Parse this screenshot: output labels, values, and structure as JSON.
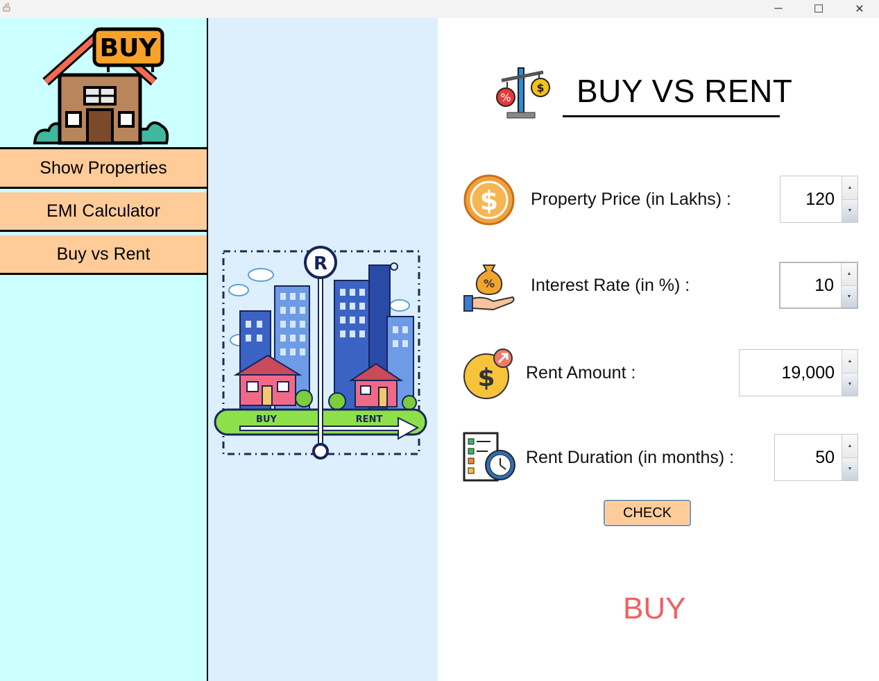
{
  "window": {
    "minimize_glyph": "─",
    "maximize_glyph": "☐",
    "close_glyph": "✕"
  },
  "sidebar": {
    "logo_text": "BUY",
    "items": [
      {
        "label": "Show Properties"
      },
      {
        "label": "EMI Calculator"
      },
      {
        "label": "Buy vs Rent"
      }
    ]
  },
  "illustration": {
    "left_label": "BUY",
    "right_label": "RENT",
    "center_letter": "R"
  },
  "main": {
    "title": "BUY VS RENT",
    "fields": [
      {
        "label": "Property Price (in Lakhs) :",
        "value": "120",
        "icon": "dollar-coin-icon"
      },
      {
        "label": "Interest Rate (in %) :",
        "value": "10",
        "icon": "money-bag-hand-icon"
      },
      {
        "label": "Rent Amount :",
        "value": "19,000",
        "icon": "dollar-growth-icon"
      },
      {
        "label": "Rent Duration (in months) :",
        "value": "50",
        "icon": "checklist-clock-icon"
      }
    ],
    "check_label": "CHECK",
    "result": "BUY"
  },
  "colors": {
    "sidebar_bg": "#ccffff",
    "nav_button_bg": "#ffcc99",
    "middle_bg": "#ddeefc",
    "result_text": "#f06060"
  }
}
